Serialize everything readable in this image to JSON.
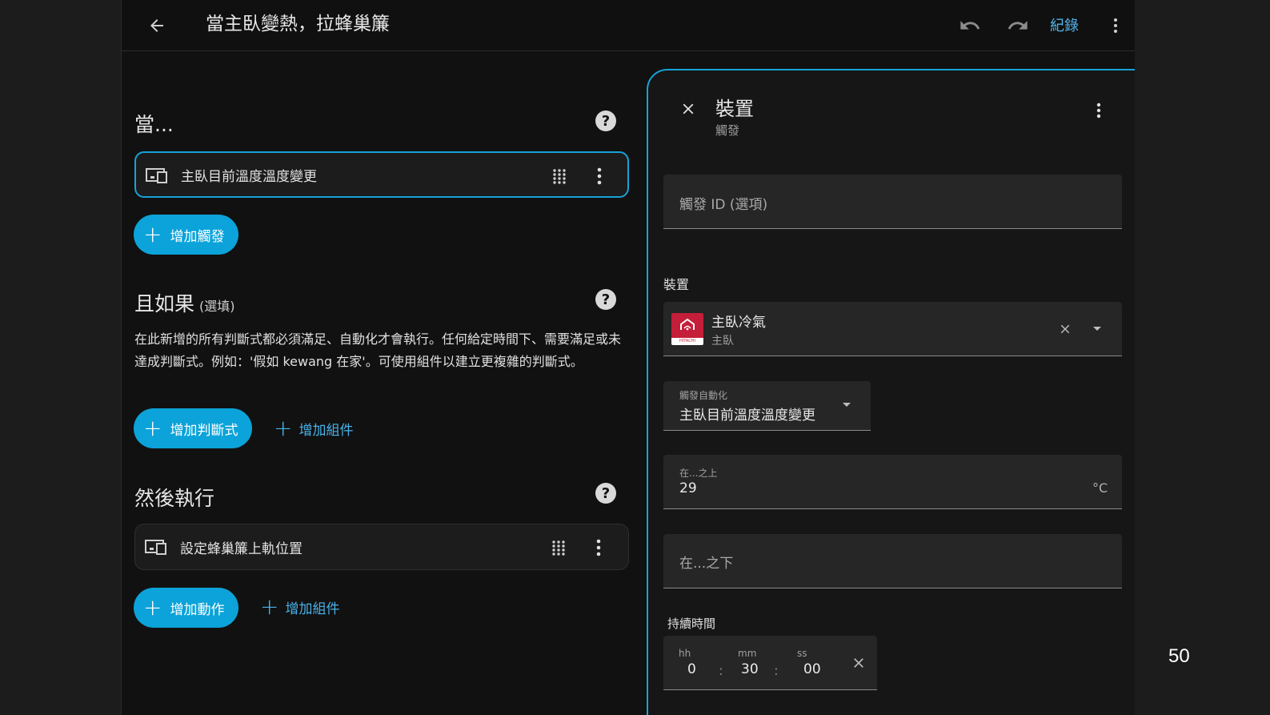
{
  "topbar": {
    "title": "當主臥變熱，拉蜂巢簾",
    "history_label": "紀錄"
  },
  "triggers": {
    "heading": "當...",
    "items": [
      {
        "label": "主臥目前溫度溫度變更"
      }
    ],
    "add_label": "增加觸發"
  },
  "conditions": {
    "heading": "且如果",
    "optional": "(選填)",
    "description": "在此新增的所有判斷式都必須滿足、自動化才會執行。任何給定時間下、需要滿足或未達成判斷式。例如：'假如 kewang 在家'。可使用組件以建立更複雜的判斷式。",
    "add_label": "增加判斷式",
    "add_block_label": "增加組件"
  },
  "actions": {
    "heading": "然後執行",
    "items": [
      {
        "label": "設定蜂巢簾上軌位置"
      }
    ],
    "add_label": "增加動作",
    "add_block_label": "增加組件"
  },
  "panel": {
    "title": "裝置",
    "subtitle": "觸發",
    "trigger_id_placeholder": "觸發 ID (選項)",
    "device_label": "裝置",
    "device_name": "主臥冷氣",
    "device_area": "主臥",
    "brand_text": "HITACHI",
    "trigger_select_label": "觸發自動化",
    "trigger_select_value": "主臥目前溫度溫度變更",
    "above_label": "在...之上",
    "above_value": "29",
    "above_unit": "°C",
    "below_placeholder": "在...之下",
    "duration_label": "持續時間",
    "duration": {
      "hh_label": "hh",
      "hh_value": "0",
      "mm_label": "mm",
      "mm_value": "30",
      "ss_label": "ss",
      "ss_value": "00"
    }
  },
  "slide_number": "50",
  "colors": {
    "accent": "#0ba3d9",
    "link": "#48b2ea",
    "background": "#111111",
    "brand_red": "#c41e3a"
  }
}
